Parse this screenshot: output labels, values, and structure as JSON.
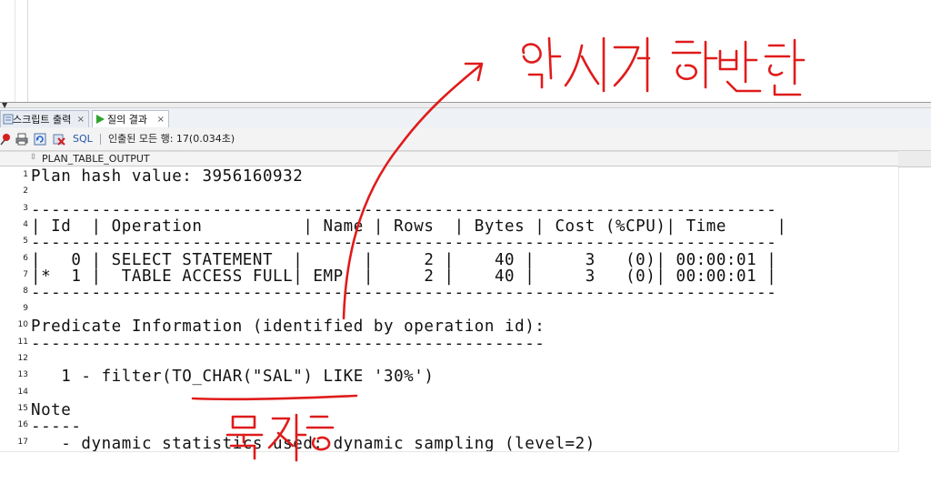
{
  "tabs": [
    {
      "label": "스크립트 출력",
      "close": "×",
      "icon": "script-output-icon"
    },
    {
      "label": "질의 결과",
      "close": "×",
      "icon": "run-query-icon"
    }
  ],
  "toolbar": {
    "sql_label": "SQL",
    "status": "인출된 모든 행: 17(0.034초)"
  },
  "grid": {
    "column": "PLAN_TABLE_OUTPUT",
    "rows": [
      {
        "n": "1",
        "text": "Plan hash value: 3956160932"
      },
      {
        "n": "2",
        "text": ""
      },
      {
        "n": "3",
        "text": "--------------------------------------------------------------------------"
      },
      {
        "n": "4",
        "text": "| Id  | Operation          | Name | Rows  | Bytes | Cost (%CPU)| Time     |"
      },
      {
        "n": "5",
        "text": "--------------------------------------------------------------------------"
      },
      {
        "n": "6",
        "text": "|   0 | SELECT STATEMENT  |      |     2 |    40 |     3   (0)| 00:00:01 |"
      },
      {
        "n": "7",
        "text": "|*  1 |  TABLE ACCESS FULL| EMP  |     2 |    40 |     3   (0)| 00:00:01 |"
      },
      {
        "n": "8",
        "text": "--------------------------------------------------------------------------"
      },
      {
        "n": "9",
        "text": ""
      },
      {
        "n": "10",
        "text": "Predicate Information (identified by operation id):"
      },
      {
        "n": "11",
        "text": "---------------------------------------------------"
      },
      {
        "n": "12",
        "text": ""
      },
      {
        "n": "13",
        "text": "   1 - filter(TO_CHAR(\"SAL\") LIKE '30%')"
      },
      {
        "n": "14",
        "text": ""
      },
      {
        "n": "15",
        "text": "Note"
      },
      {
        "n": "16",
        "text": "-----"
      },
      {
        "n": "17",
        "text": "   - dynamic statistics used: dynamic sampling (level=2)"
      }
    ]
  },
  "colors": {
    "annotation": "#e01b1b",
    "sql_link": "#1f55a8"
  }
}
